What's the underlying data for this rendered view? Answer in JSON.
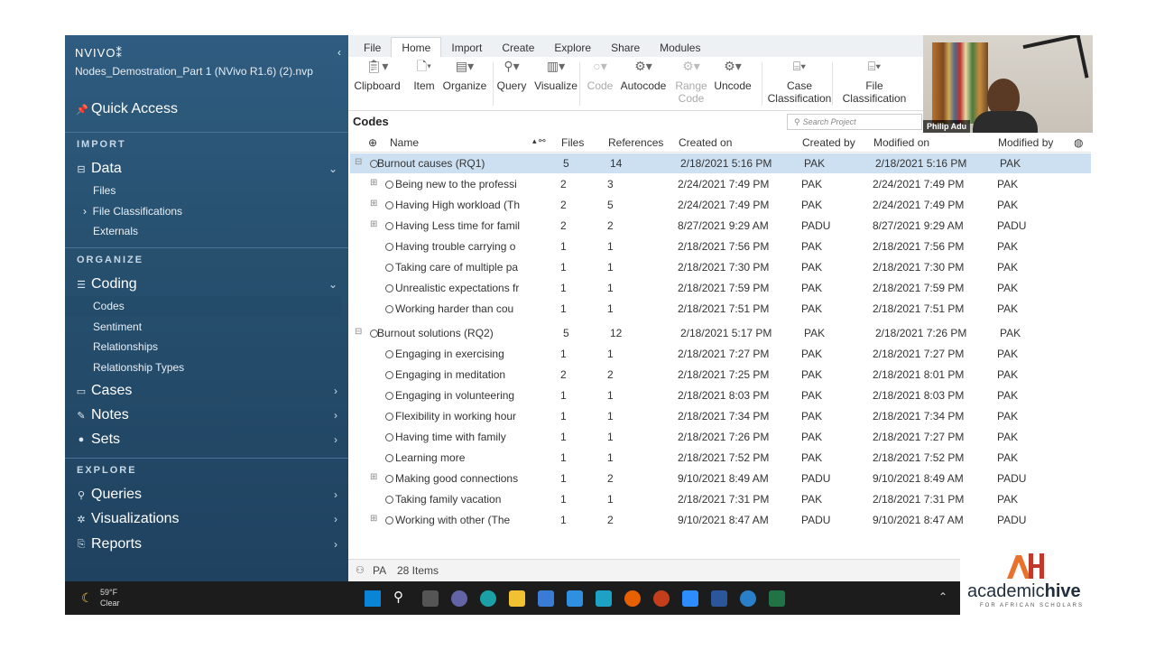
{
  "app": {
    "brand": "NVIVO",
    "logo_mark": "⁑",
    "project_file": "Nodes_Demostration_Part 1 (NVivo R1.6) (2).nvp"
  },
  "sidebar": {
    "quick_access": "Quick Access",
    "sections": {
      "import": "IMPORT",
      "organize": "ORGANIZE",
      "explore": "EXPLORE"
    },
    "data": {
      "label": "Data",
      "items": [
        "Files",
        "File Classifications",
        "Externals"
      ]
    },
    "coding": {
      "label": "Coding",
      "items": [
        "Codes",
        "Sentiment",
        "Relationships",
        "Relationship Types"
      ]
    },
    "cases": "Cases",
    "notes": "Notes",
    "sets": "Sets",
    "queries": "Queries",
    "visualizations": "Visualizations",
    "reports": "Reports"
  },
  "ribbon": {
    "tabs": [
      "File",
      "Home",
      "Import",
      "Create",
      "Explore",
      "Share",
      "Modules"
    ],
    "active_tab": "Home",
    "buttons": [
      {
        "label": "Clipboard",
        "icon": "clipboard-icon"
      },
      {
        "label": "Item",
        "icon": "item-icon"
      },
      {
        "label": "Organize",
        "icon": "organize-icon"
      },
      {
        "label": "Query",
        "icon": "query-icon"
      },
      {
        "label": "Visualize",
        "icon": "visualize-icon"
      },
      {
        "label": "Code",
        "icon": "code-icon",
        "disabled": true
      },
      {
        "label": "Autocode",
        "icon": "autocode-icon"
      },
      {
        "label": "Range Code",
        "icon": "range-code-icon",
        "disabled": true
      },
      {
        "label": "Uncode",
        "icon": "uncode-icon"
      },
      {
        "label": "Case Classification",
        "icon": "case-classification-icon"
      },
      {
        "label": "File Classification",
        "icon": "file-classification-icon"
      }
    ]
  },
  "codes_panel": {
    "title": "Codes",
    "search_placeholder": "Search Project"
  },
  "video": {
    "presenter": "Philip Adu"
  },
  "table": {
    "columns": [
      "Name",
      "Files",
      "References",
      "Created on",
      "Created by",
      "Modified on",
      "Modified by"
    ],
    "rows": [
      {
        "level": 0,
        "expand": "⊟",
        "name": "Burnout causes (RQ1)",
        "files": "5",
        "refs": "14",
        "created": "2/18/2021 5:16 PM",
        "cby": "PAK",
        "modified": "2/18/2021 5:16 PM",
        "mby": "PAK",
        "selected": true
      },
      {
        "level": 1,
        "expand": "⊞",
        "name": "Being new to the professi",
        "files": "2",
        "refs": "3",
        "created": "2/24/2021 7:49 PM",
        "cby": "PAK",
        "modified": "2/24/2021 7:49 PM",
        "mby": "PAK"
      },
      {
        "level": 1,
        "expand": "⊞",
        "name": "Having High workload (Th",
        "files": "2",
        "refs": "5",
        "created": "2/24/2021 7:49 PM",
        "cby": "PAK",
        "modified": "2/24/2021 7:49 PM",
        "mby": "PAK"
      },
      {
        "level": 1,
        "expand": "⊞",
        "name": "Having Less time for famil",
        "files": "2",
        "refs": "2",
        "created": "8/27/2021 9:29 AM",
        "cby": "PADU",
        "modified": "8/27/2021 9:29 AM",
        "mby": "PADU"
      },
      {
        "level": 1,
        "expand": "",
        "name": "Having trouble carrying o",
        "files": "1",
        "refs": "1",
        "created": "2/18/2021 7:56 PM",
        "cby": "PAK",
        "modified": "2/18/2021 7:56 PM",
        "mby": "PAK"
      },
      {
        "level": 1,
        "expand": "",
        "name": "Taking care of multiple pa",
        "files": "1",
        "refs": "1",
        "created": "2/18/2021 7:30 PM",
        "cby": "PAK",
        "modified": "2/18/2021 7:30 PM",
        "mby": "PAK"
      },
      {
        "level": 1,
        "expand": "",
        "name": "Unrealistic expectations fr",
        "files": "1",
        "refs": "1",
        "created": "2/18/2021 7:59 PM",
        "cby": "PAK",
        "modified": "2/18/2021 7:59 PM",
        "mby": "PAK"
      },
      {
        "level": 1,
        "expand": "",
        "name": "Working harder than cou",
        "files": "1",
        "refs": "1",
        "created": "2/18/2021 7:51 PM",
        "cby": "PAK",
        "modified": "2/18/2021 7:51 PM",
        "mby": "PAK"
      },
      {
        "level": 0,
        "expand": "⊟",
        "name": "Burnout solutions (RQ2)",
        "files": "5",
        "refs": "12",
        "created": "2/18/2021 5:17 PM",
        "cby": "PAK",
        "modified": "2/18/2021 7:26 PM",
        "mby": "PAK"
      },
      {
        "level": 1,
        "expand": "",
        "name": "Engaging in exercising",
        "files": "1",
        "refs": "1",
        "created": "2/18/2021 7:27 PM",
        "cby": "PAK",
        "modified": "2/18/2021 7:27 PM",
        "mby": "PAK"
      },
      {
        "level": 1,
        "expand": "",
        "name": "Engaging in meditation",
        "files": "2",
        "refs": "2",
        "created": "2/18/2021 7:25 PM",
        "cby": "PAK",
        "modified": "2/18/2021 8:01 PM",
        "mby": "PAK"
      },
      {
        "level": 1,
        "expand": "",
        "name": "Engaging in volunteering",
        "files": "1",
        "refs": "1",
        "created": "2/18/2021 8:03 PM",
        "cby": "PAK",
        "modified": "2/18/2021 8:03 PM",
        "mby": "PAK"
      },
      {
        "level": 1,
        "expand": "",
        "name": "Flexibility in working hour",
        "files": "1",
        "refs": "1",
        "created": "2/18/2021 7:34 PM",
        "cby": "PAK",
        "modified": "2/18/2021 7:34 PM",
        "mby": "PAK"
      },
      {
        "level": 1,
        "expand": "",
        "name": "Having time with family",
        "files": "1",
        "refs": "1",
        "created": "2/18/2021 7:26 PM",
        "cby": "PAK",
        "modified": "2/18/2021 7:27 PM",
        "mby": "PAK"
      },
      {
        "level": 1,
        "expand": "",
        "name": "Learning more",
        "files": "1",
        "refs": "1",
        "created": "2/18/2021 7:52 PM",
        "cby": "PAK",
        "modified": "2/18/2021 7:52 PM",
        "mby": "PAK"
      },
      {
        "level": 1,
        "expand": "⊞",
        "name": "Making good connections",
        "files": "1",
        "refs": "2",
        "created": "9/10/2021 8:49 AM",
        "cby": "PADU",
        "modified": "9/10/2021 8:49 AM",
        "mby": "PADU"
      },
      {
        "level": 1,
        "expand": "",
        "name": "Taking family vacation",
        "files": "1",
        "refs": "1",
        "created": "2/18/2021 7:31 PM",
        "cby": "PAK",
        "modified": "2/18/2021 7:31 PM",
        "mby": "PAK"
      },
      {
        "level": 1,
        "expand": "⊞",
        "name": "Working with other (The",
        "files": "1",
        "refs": "2",
        "created": "9/10/2021 8:47 AM",
        "cby": "PADU",
        "modified": "9/10/2021 8:47 AM",
        "mby": "PADU"
      }
    ]
  },
  "status": {
    "user": "PA",
    "count": "28 Items"
  },
  "weather": {
    "temp": "59°F",
    "desc": "Clear"
  },
  "watermark": {
    "brand_a": "academic",
    "brand_b": "hive",
    "tagline": "FOR AFRICAN SCHOLARS",
    "colors": {
      "orange": "#e8722c",
      "red": "#c0392b",
      "dark": "#1f2d3d"
    }
  }
}
